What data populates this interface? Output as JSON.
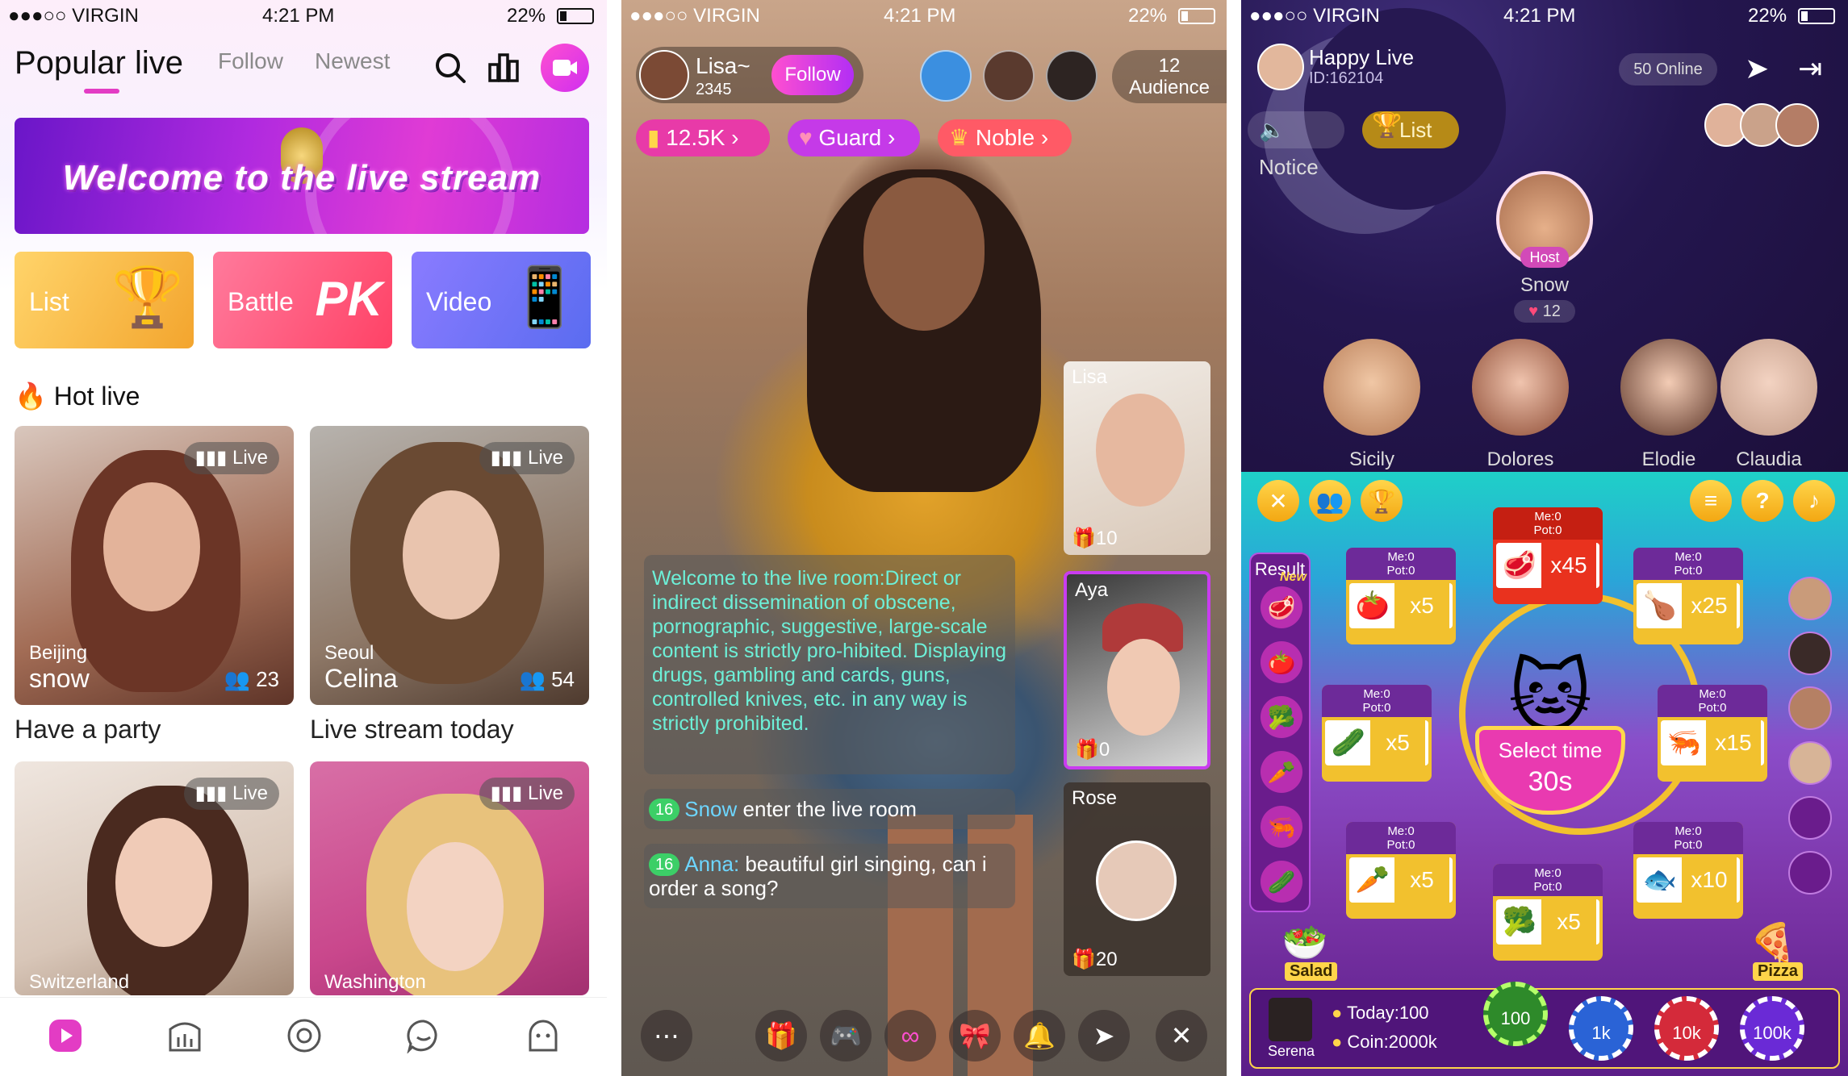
{
  "screen1": {
    "status": {
      "carrier": "●●●○○ VIRGIN",
      "time": "4:21 PM",
      "battery": "22%"
    },
    "tabs": [
      "Popular live",
      "Follow",
      "Newest"
    ],
    "banner": {
      "text": "Welcome to the live stream"
    },
    "categories": [
      {
        "label": "List",
        "color": "#f6c248"
      },
      {
        "label": "Battle",
        "color": "#ff5a8a"
      },
      {
        "label": "Video",
        "color": "#6f7bff"
      }
    ],
    "section_title": "Hot live",
    "cards": [
      {
        "badge": "Live",
        "city": "Beijing",
        "name": "snow",
        "viewers": "23",
        "caption": "Have a party"
      },
      {
        "badge": "Live",
        "city": "Seoul",
        "name": "Celina",
        "viewers": "54",
        "caption": "Live stream today"
      },
      {
        "badge": "Live",
        "city": "Switzerland"
      },
      {
        "badge": "Live",
        "city": "Washington"
      }
    ]
  },
  "screen2": {
    "status": {
      "carrier": "●●●○○ VIRGIN",
      "time": "4:21 PM",
      "battery": "22%"
    },
    "host": {
      "name": "Lisa~",
      "id": "2345",
      "follow_label": "Follow"
    },
    "audience": {
      "count": "12",
      "label": "Audience"
    },
    "pills": [
      {
        "label": "12.5K",
        "color": "#e83aa8"
      },
      {
        "label": "Guard",
        "color": "#c53ae8"
      },
      {
        "label": "Noble",
        "color": "#ff5a66"
      }
    ],
    "side_videos": [
      {
        "name": "Lisa",
        "count": "10"
      },
      {
        "name": "Aya",
        "count": "0"
      },
      {
        "name": "Rose",
        "count": "20"
      }
    ],
    "notice": "Welcome to the live room:Direct or indirect dissemination of obscene, pornographic, suggestive, large-scale content is strictly pro-hibited. Displaying drugs, gambling and cards, guns, controlled knives, etc. in any way is strictly prohibited.",
    "messages": [
      {
        "level": "16",
        "nick": "Snow",
        "text": " enter the live room"
      },
      {
        "level": "16",
        "nick": "Anna:",
        "text": " beautiful girl singing, can i order a song?"
      }
    ]
  },
  "screen3": {
    "status": {
      "carrier": "●●●○○ VIRGIN",
      "time": "4:21 PM",
      "battery": "22%"
    },
    "room": {
      "title": "Happy Live",
      "id": "ID:162104",
      "online": "50 Online"
    },
    "notice_label": "Notice",
    "list_label": "List",
    "host": {
      "tag": "Host",
      "name": "Snow",
      "hearts": "12"
    },
    "seats": [
      "Sicily",
      "Dolores",
      "Elodie",
      "Claudia"
    ],
    "game": {
      "result_label": "Result",
      "new_label": "New",
      "boxes": [
        {
          "stats": "Me:0\nPot:0",
          "item": "🥩",
          "mult": "x45"
        },
        {
          "stats": "Me:0\nPot:0",
          "item": "🍅",
          "mult": "x5"
        },
        {
          "stats": "Me:0\nPot:0",
          "item": "🍗",
          "mult": "x25"
        },
        {
          "stats": "Me:0\nPot:0",
          "item": "🥒",
          "mult": "x5"
        },
        {
          "stats": "Me:0\nPot:0",
          "item": "🦐",
          "mult": "x15"
        },
        {
          "stats": "Me:0\nPot:0",
          "item": "🥕",
          "mult": "x5"
        },
        {
          "stats": "Me:0\nPot:0",
          "item": "🐟",
          "mult": "x10"
        },
        {
          "stats": "Me:0\nPot:0",
          "item": "🥦",
          "mult": "x5"
        }
      ],
      "select_label": "Select time",
      "select_value": "30s",
      "salad_label": "Salad",
      "pizza_label": "Pizza",
      "player": "Serena",
      "today": "Today:100",
      "coin": "Coin:2000k",
      "chips": [
        "100",
        "1k",
        "10k",
        "100k"
      ]
    }
  }
}
